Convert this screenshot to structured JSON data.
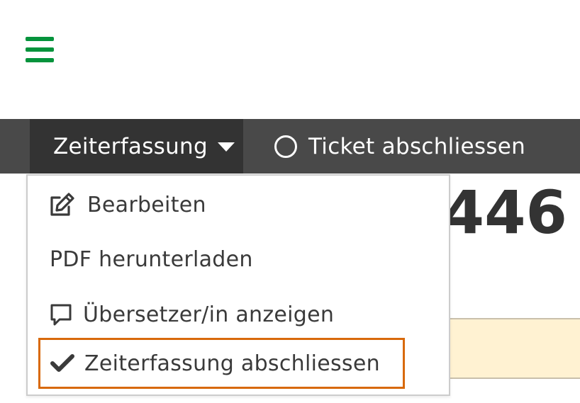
{
  "header": {
    "menu_icon": "hamburger-menu-icon",
    "brand_color": "#05933c"
  },
  "toolbar": {
    "time_tracking_label": "Zeiterfassung",
    "close_ticket_label": "Ticket abschliessen",
    "background_color": "#494949"
  },
  "main": {
    "big_number": "446"
  },
  "dropdown": {
    "items": [
      {
        "label": "Bearbeiten",
        "icon": "edit-icon"
      },
      {
        "label": "PDF herunterladen",
        "icon": ""
      },
      {
        "label": "Übersetzer/in anzeigen",
        "icon": "chat-bubble-icon"
      },
      {
        "label": "Zeiterfassung abschliessen",
        "icon": "check-icon",
        "focused": true
      }
    ],
    "focus_color": "#d8690b"
  }
}
